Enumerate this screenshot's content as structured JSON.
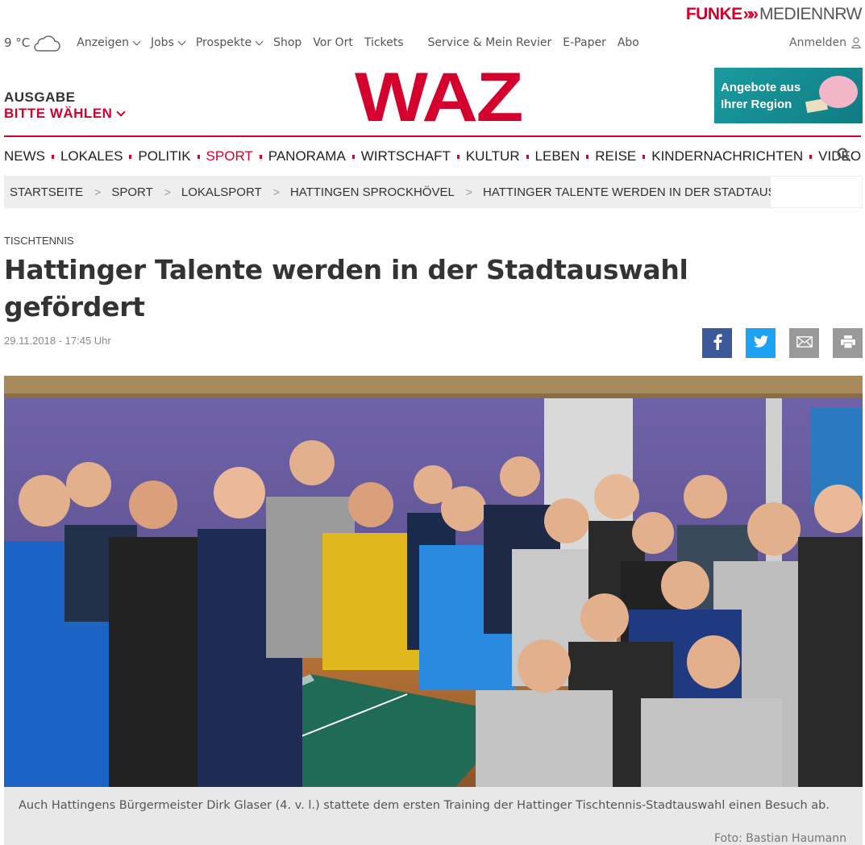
{
  "brand": {
    "part1": "FUNKE",
    "arrows": "»»",
    "part2": "MEDIENNRW"
  },
  "weather": {
    "temp": "9 °C",
    "icon": "cloud-icon"
  },
  "topnav": [
    {
      "label": "Anzeigen",
      "dropdown": true
    },
    {
      "label": "Jobs",
      "dropdown": true
    },
    {
      "label": "Prospekte",
      "dropdown": true
    },
    {
      "label": "Shop"
    },
    {
      "label": "Vor Ort"
    },
    {
      "label": "Tickets"
    },
    {
      "label": "Service & Mein Revier"
    },
    {
      "label": "E-Paper"
    },
    {
      "label": "Abo"
    }
  ],
  "login": {
    "label": "Anmelden",
    "icon": "user-icon"
  },
  "edition": {
    "label": "AUSGABE",
    "select": "BITTE WÄHLEN"
  },
  "logo": "WAZ",
  "promo": {
    "line1": "Angebote aus",
    "line2": "Ihrer Region"
  },
  "mainnav": [
    {
      "label": "NEWS"
    },
    {
      "label": "LOKALES"
    },
    {
      "label": "POLITIK"
    },
    {
      "label": "SPORT",
      "active": true
    },
    {
      "label": "PANORAMA"
    },
    {
      "label": "WIRTSCHAFT"
    },
    {
      "label": "KULTUR"
    },
    {
      "label": "LEBEN"
    },
    {
      "label": "REISE"
    },
    {
      "label": "KINDERNACHRICHTEN"
    },
    {
      "label": "VIDEO"
    }
  ],
  "breadcrumb": [
    "STARTSEITE",
    "SPORT",
    "LOKALSPORT",
    "HATTINGEN SPROCKHÖVEL",
    "HATTINGER TALENTE WERDEN IN DER STADTAUSWAHL GEF"
  ],
  "article": {
    "kicker": "TISCHTENNIS",
    "headline": "Hattinger Talente werden in der Stadtauswahl gefördert",
    "date": "29.11.2018 - 17:45 Uhr",
    "caption": "Auch Hattingens Bürgermeister Dirk Glaser (4. v. l.) stattete dem ersten Training der Hattinger Tischtennis-Stadtauswahl einen Besuch ab.",
    "credit": "Foto: Bastian Haumann"
  },
  "colors": {
    "brand_red": "#d4002d",
    "facebook": "#3b5998",
    "twitter": "#1da1f2",
    "grey_button": "#999999"
  }
}
